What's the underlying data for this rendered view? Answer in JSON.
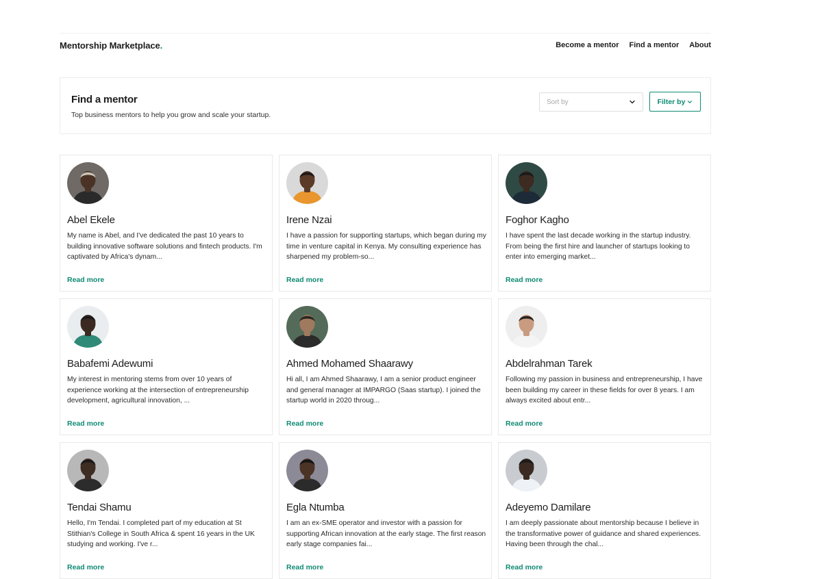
{
  "brand": {
    "name": "Mentorship Marketplace",
    "dot": "."
  },
  "nav": {
    "items": [
      "Become a mentor",
      "Find a mentor",
      "About"
    ]
  },
  "find": {
    "title": "Find a mentor",
    "subtitle": "Top business mentors to help you grow and scale your startup.",
    "sort_placeholder": "Sort by",
    "filter_label": "Filter by"
  },
  "colors": {
    "accent": "#0f8a74",
    "text": "#1c1c1c",
    "border": "#e9e9e9"
  },
  "read_more": "Read more",
  "mentors": [
    {
      "name": "Abel Ekele",
      "bio": "My name is Abel, and I've dedicated the past 10 years to building innovative software solutions and fintech products. I'm captivated by Africa's dynam...",
      "avatar": {
        "bg": "#6f6a66",
        "skin": "#4a3325",
        "shirt": "#2a2a2a",
        "hair": "#c9c2b6"
      }
    },
    {
      "name": "Irene Nzai",
      "bio": "I have a passion for supporting startups, which began during my time in venture capital in Kenya. My consulting experience has sharpened my problem-so...",
      "avatar": {
        "bg": "#d9d9d9",
        "skin": "#5b3a28",
        "shirt": "#e8962d",
        "hair": "#1e1a18"
      }
    },
    {
      "name": "Foghor Kagho",
      "bio": "I have spent the last decade working in the startup industry. From being the first hire and launcher of startups looking to enter into emerging market...",
      "avatar": {
        "bg": "#2f4a44",
        "skin": "#3d2a20",
        "shirt": "#1d2a38",
        "hair": "#1a1a1a"
      }
    },
    {
      "name": "Babafemi Adewumi",
      "bio": "My interest in mentoring stems from over 10 years of experience working at the intersection of entrepreneurship development, agricultural innovation, ...",
      "avatar": {
        "bg": "#e9edf0",
        "skin": "#3b2a22",
        "shirt": "#2f8a78",
        "hair": "#1a1a1a"
      }
    },
    {
      "name": "Ahmed Mohamed Shaarawy",
      "bio": "Hi all, I am Ahmed Shaarawy, I am a senior product engineer and general manager at IMPARGO (Saas startup). I joined the startup world in 2020 throug...",
      "avatar": {
        "bg": "#556b5a",
        "skin": "#a07a5f",
        "shirt": "#2b2b2b",
        "hair": "#2a2420"
      }
    },
    {
      "name": "Abdelrahman Tarek",
      "bio": "Following my passion in business and entrepreneurship, I have been building my career in these fields for over 8 years. I am always excited about entr...",
      "avatar": {
        "bg": "#eeeeee",
        "skin": "#c99b80",
        "shirt": "#f4f4f4",
        "hair": "#2a2220"
      }
    },
    {
      "name": "Tendai Shamu",
      "bio": "Hello, I'm Tendai. I completed part of my education at St Stithian's College in South Africa & spent 16 years in the UK studying and working. I've r...",
      "avatar": {
        "bg": "#b8b8b8",
        "skin": "#3f2c22",
        "shirt": "#2c2c2c",
        "hair": "#1a1a1a"
      }
    },
    {
      "name": "Egla Ntumba",
      "bio": "I am an ex-SME operator and investor with a passion for supporting African innovation at the early stage. The first reason early stage companies fai...",
      "avatar": {
        "bg": "#8c8a96",
        "skin": "#4b3326",
        "shirt": "#2b2b2b",
        "hair": "#141414"
      }
    },
    {
      "name": "Adeyemo Damilare",
      "bio": "I am deeply passionate about mentorship because I believe in the transformative power of guidance and shared experiences. Having been through the chal...",
      "avatar": {
        "bg": "#c8ccd0",
        "skin": "#3b2a22",
        "shirt": "#eef2f6",
        "hair": "#1a1a1a"
      }
    }
  ]
}
